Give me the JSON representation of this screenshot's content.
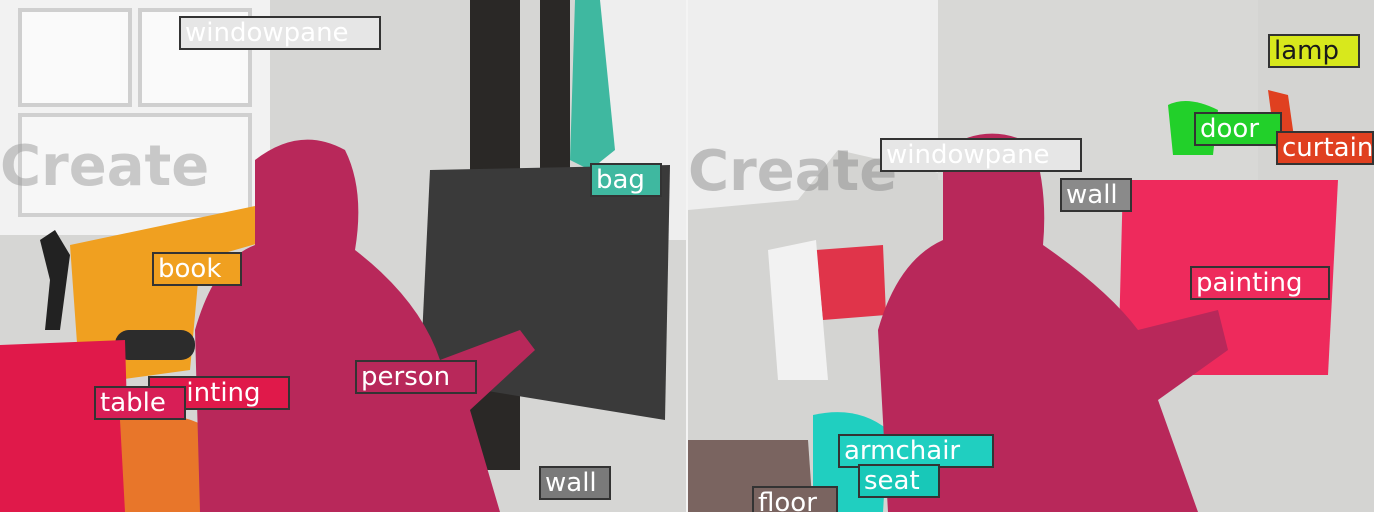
{
  "left_labels": [
    {
      "text": "windowpane",
      "color": "#e6e6e6",
      "dark": false
    },
    {
      "text": "book",
      "color": "#f0a020",
      "dark": false
    },
    {
      "text": "bag",
      "color": "#3fb8a0",
      "dark": false
    },
    {
      "text": "painting",
      "color": "#e0194a",
      "dark": false
    },
    {
      "text": "table",
      "color": "#d81e56",
      "dark": false
    },
    {
      "text": "person",
      "color": "#b8285a",
      "dark": false
    },
    {
      "text": "wall",
      "color": "#7a7a7a",
      "dark": false
    }
  ],
  "right_labels": [
    {
      "text": "lamp",
      "color": "#d8e81c",
      "dark": false
    },
    {
      "text": "door",
      "color": "#22d02a",
      "dark": false
    },
    {
      "text": "curtain",
      "color": "#e04020",
      "dark": false
    },
    {
      "text": "windowpane",
      "color": "#e6e6e6",
      "dark": false
    },
    {
      "text": "wall",
      "color": "#8a8a8a",
      "dark": false
    },
    {
      "text": "painting",
      "color": "#ee2a5c",
      "dark": false
    },
    {
      "text": "armchair",
      "color": "#20cfc0",
      "dark": false
    },
    {
      "text": "seat",
      "color": "#18c8b8",
      "dark": false
    },
    {
      "text": "floor",
      "color": "#7a6460",
      "dark": false
    }
  ]
}
